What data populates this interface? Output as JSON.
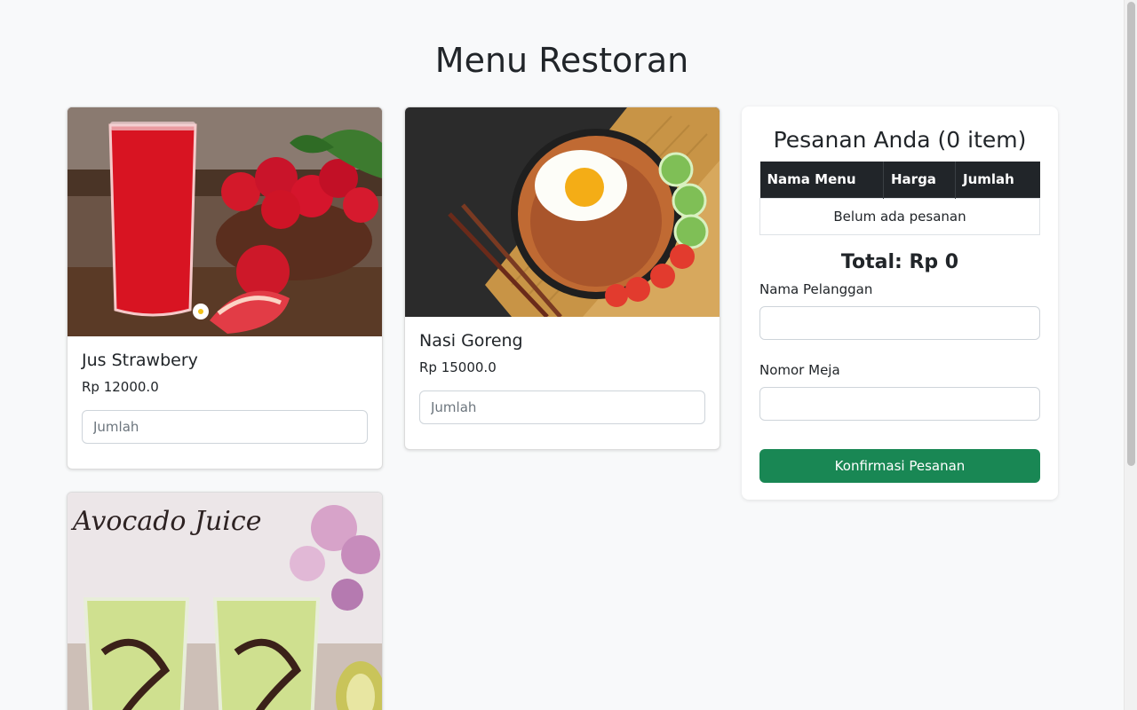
{
  "page": {
    "title": "Menu Restoran"
  },
  "menu": [
    {
      "name": "Jus Strawbery",
      "price": "Rp 12000.0",
      "qty_placeholder": "Jumlah",
      "image": "strawberry-juice"
    },
    {
      "name": "Nasi Goreng",
      "price": "Rp 15000.0",
      "qty_placeholder": "Jumlah",
      "image": "fried-rice"
    },
    {
      "name": "",
      "price": "",
      "qty_placeholder": "",
      "image": "avocado-juice",
      "image_caption": "Avocado Juice"
    }
  ],
  "order": {
    "title": "Pesanan Anda (0 item)",
    "columns": [
      "Nama Menu",
      "Harga",
      "Jumlah"
    ],
    "empty_text": "Belum ada pesanan",
    "total": "Total: Rp 0",
    "customer_label": "Nama Pelanggan",
    "customer_value": "",
    "table_label": "Nomor Meja",
    "table_value": "",
    "confirm_label": "Konfirmasi Pesanan"
  },
  "colors": {
    "confirm": "#198754",
    "table_header": "#212529",
    "background": "#f8f9fa"
  }
}
